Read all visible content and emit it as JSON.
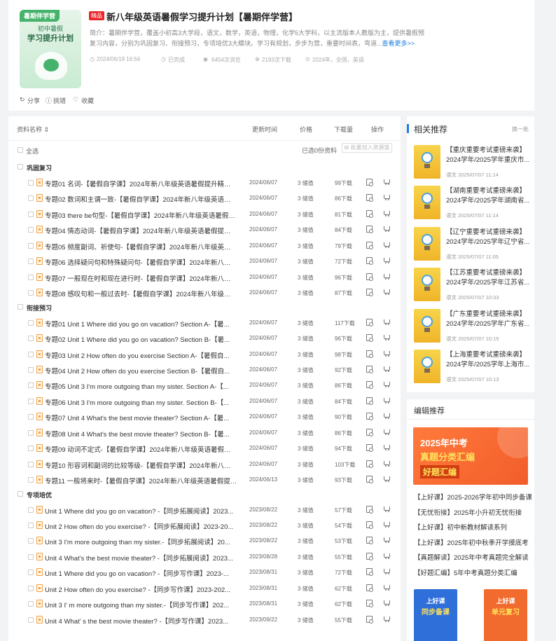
{
  "product": {
    "cover_tag": "暑期伴学营",
    "cover_line1": "初中暑假",
    "cover_line2": "学习提升计划",
    "badge": "精品",
    "title": "新八年级英语暑假学习提升计划【暑期伴学营】",
    "intro": "简介：暑期伴学营，覆盖小初高3大学段，语文，数学，英语，物理，化学5大学科，以主流版本人教版为主，提供暑假预复习内容，分别为巩固复习、衔接预习，专项培优3大模块。学习有规划，步步为营，重要时间表，弯道...",
    "more": "查看更多>>",
    "meta": {
      "date": "2024/06/19 16:56",
      "status": "已完成",
      "views": "6454次浏览",
      "downloads": "2193次下载",
      "scope": "2024年，全国，英语"
    },
    "actions": {
      "share": "分享",
      "report": "挑错",
      "favorite": "收藏"
    }
  },
  "list": {
    "headers": {
      "name": "资料名称",
      "updated": "更新时间",
      "price": "价格",
      "downloads": "下载量",
      "ops": "操作"
    },
    "select_all": "全选",
    "selected_info": "已选0份资料",
    "batch_button": "批量加入资源篮",
    "sections": [
      {
        "title": "巩固复习",
        "items": [
          {
            "name": "专题01 名词-【暑假自学课】2024年新八年级英语暑假提升精品讲...",
            "date": "2024/06/07",
            "price": "3 储值",
            "downloads": "99下载"
          },
          {
            "name": "专题02 数词和主谓一致-【暑假自学课】2024年新八年级英语暑假...",
            "date": "2024/06/07",
            "price": "3 储值",
            "downloads": "86下载"
          },
          {
            "name": "专题03 there be句型-【暑假自学课】2024年新八年级英语暑假提...",
            "date": "2024/06/07",
            "price": "3 储值",
            "downloads": "81下载"
          },
          {
            "name": "专题04 情态动词-【暑假自学课】2024年新八年级英语暑假提升精...",
            "date": "2024/06/07",
            "price": "3 储值",
            "downloads": "84下载"
          },
          {
            "name": "专题05 频度副词、祈使句-【暑假自学课】2024年新八年级英语暑...",
            "date": "2024/06/07",
            "price": "3 储值",
            "downloads": "79下载"
          },
          {
            "name": "专题06 选择疑问句和特殊疑问句-【暑假自学课】2024年新八年级...",
            "date": "2024/06/07",
            "price": "3 储值",
            "downloads": "72下载"
          },
          {
            "name": "专题07 一般现在时和现在进行时-【暑假自学课】2024年新八年级...",
            "date": "2024/06/07",
            "price": "3 储值",
            "downloads": "96下载"
          },
          {
            "name": "专题08 感叹句和一般过去时-【暑假自学课】2024年新八年级英语...",
            "date": "2024/06/07",
            "price": "3 储值",
            "downloads": "87下载"
          }
        ]
      },
      {
        "title": "衔接预习",
        "items": [
          {
            "name": "专题01 Unit 1 Where did you go on vacation?  Section A-【暑...",
            "date": "2024/06/07",
            "price": "3 储值",
            "downloads": "117下载"
          },
          {
            "name": "专题02 Unit 1 Where did you go on vacation?  Section B-【暑...",
            "date": "2024/06/07",
            "price": "3 储值",
            "downloads": "96下载"
          },
          {
            "name": "专题03 Unit 2 How often do you exercise Section A-【暑假自...",
            "date": "2024/06/07",
            "price": "3 储值",
            "downloads": "98下载"
          },
          {
            "name": "专题04 Unit 2 How often do you exercise Section B-【暑假自...",
            "date": "2024/06/07",
            "price": "3 储值",
            "downloads": "92下载"
          },
          {
            "name": "专题05 Unit 3 I'm more outgoing than my sister. Section A-【...",
            "date": "2024/06/07",
            "price": "3 储值",
            "downloads": "86下载"
          },
          {
            "name": "专题06 Unit 3 I'm more outgoing than my sister. Section B-【...",
            "date": "2024/06/07",
            "price": "3 储值",
            "downloads": "84下载"
          },
          {
            "name": "专题07 Unit 4 What's the best movie theater?  Section A-【暑...",
            "date": "2024/06/07",
            "price": "3 储值",
            "downloads": "90下载"
          },
          {
            "name": "专题08 Unit 4 What's the best movie theater?  Section B-【暑...",
            "date": "2024/06/07",
            "price": "3 储值",
            "downloads": "86下载"
          },
          {
            "name": "专题09 动词不定式-【暑假自学课】2024年新八年级英语暑假提升...",
            "date": "2024/06/07",
            "price": "3 储值",
            "downloads": "94下载"
          },
          {
            "name": "专题10 形容词和副词的比较等级-【暑假自学课】2024年新八年级...",
            "date": "2024/06/07",
            "price": "3 储值",
            "downloads": "103下载"
          },
          {
            "name": "专题11 一般将来时-【暑假自学课】2024年新八年级英语暑假提升...",
            "date": "2024/06/13",
            "price": "3 储值",
            "downloads": "93下载"
          }
        ]
      },
      {
        "title": "专项培优",
        "items": [
          {
            "name": "Unit 1 Where did you go on vacation?  -【同步拓展阅读】2023...",
            "date": "2023/08/22",
            "price": "3 储值",
            "downloads": "57下载"
          },
          {
            "name": "Unit 2 How often do you exercise?  -【同步拓展阅读】2023-20...",
            "date": "2023/08/22",
            "price": "3 储值",
            "downloads": "54下载"
          },
          {
            "name": "Unit 3 I'm more outgoing than my sister.-【同步拓展阅读】20...",
            "date": "2023/08/22",
            "price": "3 储值",
            "downloads": "53下载"
          },
          {
            "name": "Unit 4 What's the best movie theater?  -【同步拓展阅读】2023...",
            "date": "2023/08/28",
            "price": "3 储值",
            "downloads": "55下载"
          },
          {
            "name": "Unit 1 Where did you go on vacation?  -【同步写作课】2023-...",
            "date": "2023/08/31",
            "price": "3 储值",
            "downloads": "72下载"
          },
          {
            "name": "Unit 2 How often do you exercise?  -【同步写作课】2023-202...",
            "date": "2023/08/31",
            "price": "3 储值",
            "downloads": "62下载"
          },
          {
            "name": "Unit 3 I'  m more outgoing than my sister.-【同步写作课】202...",
            "date": "2023/08/31",
            "price": "3 储值",
            "downloads": "62下载"
          },
          {
            "name": "Unit 4 What'  s the best movie theater?  -【同步写作课】2023...",
            "date": "2023/09/22",
            "price": "3 储值",
            "downloads": "55下载"
          }
        ]
      }
    ]
  },
  "related": {
    "title": "相关推荐",
    "refresh": "换一批",
    "items": [
      {
        "title": "【重庆重要考试重磅来袭】2024学年/2025学年重庆市...",
        "meta": "语文 2025/07/07 11:14"
      },
      {
        "title": "【湖南重要考试重磅来袭】2024学年/2025学年湖南省...",
        "meta": "语文 2025/07/07 11:14"
      },
      {
        "title": "【辽宁重要考试重磅来袭】2024学年/2025学年辽宁省...",
        "meta": "语文 2025/07/07 11:05"
      },
      {
        "title": "【江苏重要考试重磅来袭】2024学年/2025学年江苏省...",
        "meta": "语文 2025/07/07 10:33"
      },
      {
        "title": "【广东重要考试重磅来袭】2024学年/2025学年广东省...",
        "meta": "语文 2025/07/07 10:15"
      },
      {
        "title": "【上海重要考试重磅来袭】2024学年/2025学年上海市...",
        "meta": "语文 2025/07/07 10:13"
      }
    ]
  },
  "editor": {
    "title": "编辑推荐",
    "banner": {
      "line1": "2025年中考",
      "line2": "真题分类汇编",
      "line3": "好题汇编"
    },
    "links": [
      "【上好课】2025-2026学年初中同步备课",
      "【无忧衔接】2025年小升初无忧衔接",
      "【上好课】初中新教材解读系列",
      "【上好课】2025年初中秋季开学摸底考",
      "【真题解读】2025年中考真题完全解读",
      "【好题汇编】5年中考真题分类汇编"
    ],
    "tiles": [
      {
        "line1": "上好课",
        "line2": "同步备课",
        "color": "#2f6fd9"
      },
      {
        "line1": "上好课",
        "line2": "单元复习",
        "color": "#f26b2e"
      }
    ]
  },
  "colors": {
    "accent": "#1e7fe0",
    "badge": "#e8262a",
    "cover_green": "#45b36b"
  }
}
